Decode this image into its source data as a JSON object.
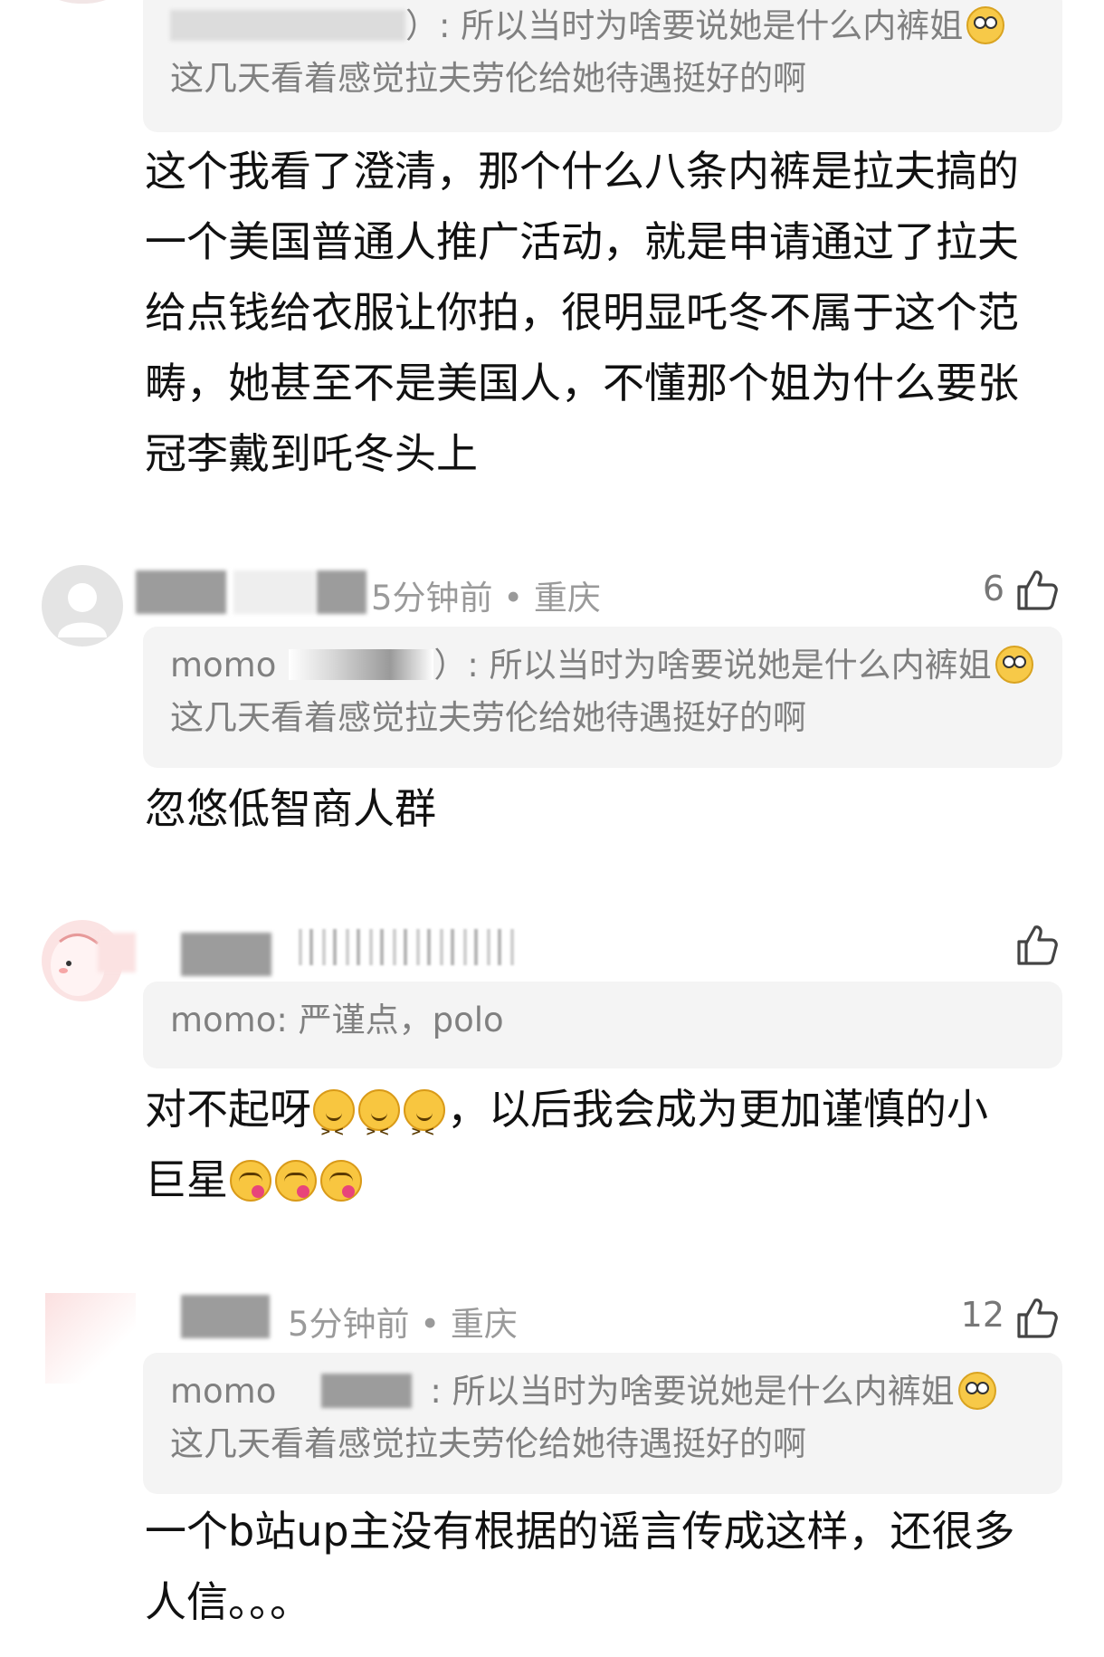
{
  "thread": [
    {
      "id": "c0",
      "quote": {
        "user": "",
        "text_line1": "）: 所以当时为啥要说她是什么内裤姐",
        "text_line2": "这几天看着感觉拉夫劳伦给她待遇挺好的啊"
      },
      "body_lines": [
        "这个我看了澄清，那个什么八条内裤是拉夫搞的",
        "一个美国普通人推广活动，就是申请通过了拉夫",
        "给点钱给衣服让你拍，很明显吒冬不属于这个范",
        "畴，她甚至不是美国人，不懂那个姐为什么要张",
        "冠李戴到吒冬头上"
      ]
    },
    {
      "id": "c1",
      "meta": "5分钟前 • 重庆",
      "likes": "6",
      "quote": {
        "user": "momo",
        "text_line1": "）: 所以当时为啥要说她是什么内裤姐",
        "text_line2": "这几天看着感觉拉夫劳伦给她待遇挺好的啊"
      },
      "body_lines": [
        "忽悠低智商人群"
      ]
    },
    {
      "id": "c2",
      "meta": "",
      "likes": "",
      "quote": {
        "user": "momo",
        "text_line1": ": 严谨点，polo",
        "text_line2": ""
      },
      "body_lines": [
        {
          "pre": "对不起呀",
          "emoji": "xd",
          "emoji_count": 3,
          "post": "，以后我会成为更加谨慎的小"
        },
        {
          "pre": "巨星",
          "emoji": "yum",
          "emoji_count": 3,
          "post": ""
        }
      ]
    },
    {
      "id": "c3",
      "meta": "5分钟前 • 重庆",
      "likes": "12",
      "quote": {
        "user": "momo",
        "text_line1": ": 所以当时为啥要说她是什么内裤姐",
        "text_line2": "这几天看着感觉拉夫劳伦给她待遇挺好的啊"
      },
      "body_lines": [
        "一个b站up主没有根据的谣言传成这样，还很多",
        "人信。。。"
      ]
    }
  ],
  "icons": {
    "like": "thumbs-up-outline-icon",
    "flushed": "flushed-face-emoji",
    "xd": "grinning-squinting-face-emoji",
    "yum": "face-savoring-food-emoji"
  },
  "colors": {
    "body_text": "#111111",
    "meta_text": "#9a9a9a",
    "quote_bg": "#f4f4f4",
    "quote_text": "#808080"
  }
}
